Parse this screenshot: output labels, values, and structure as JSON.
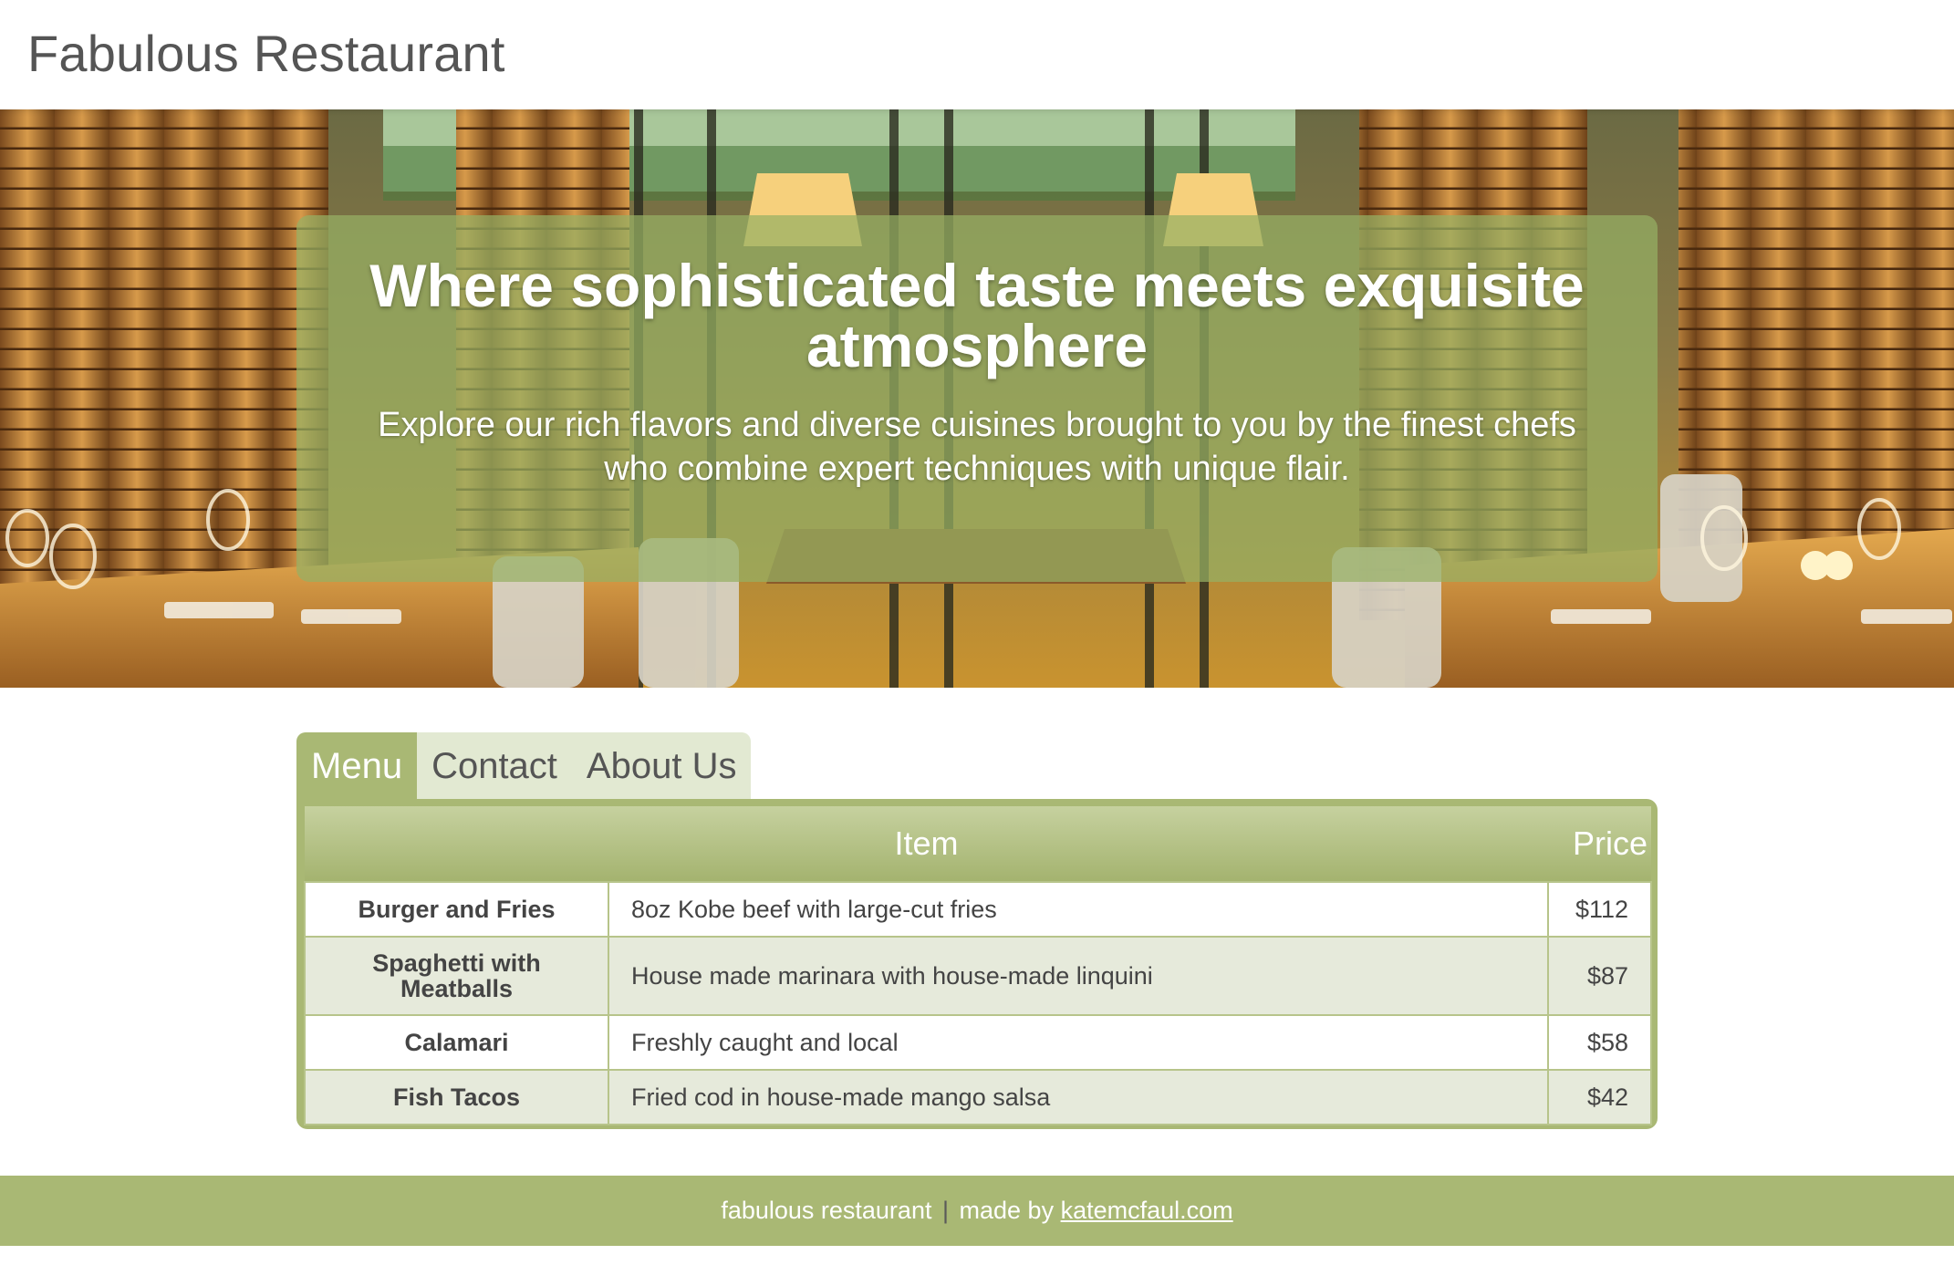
{
  "site": {
    "title": "Fabulous Restaurant"
  },
  "hero": {
    "heading": "Where sophisticated taste meets exquisite atmosphere",
    "text": "Explore our rich flavors and diverse cuisines brought to you by the finest chefs who combine expert techniques with unique flair."
  },
  "tabs": [
    {
      "label": "Menu",
      "active": true
    },
    {
      "label": "Contact",
      "active": false
    },
    {
      "label": "About Us",
      "active": false
    }
  ],
  "menu": {
    "headers": {
      "item": "Item",
      "price": "Price"
    },
    "rows": [
      {
        "name": "Burger and Fries",
        "description": "8oz Kobe beef with large-cut fries",
        "price": "$112"
      },
      {
        "name": "Spaghetti with Meatballs",
        "description": "House made marinara with house-made linquini",
        "price": "$87"
      },
      {
        "name": "Calamari",
        "description": "Freshly caught and local",
        "price": "$58"
      },
      {
        "name": "Fish Tacos",
        "description": "Fried cod in house-made mango salsa",
        "price": "$42"
      }
    ]
  },
  "footer": {
    "text": "fabulous restaurant",
    "separator": "|",
    "made_by": "made by",
    "link": "katemcfaul.com"
  },
  "colors": {
    "accent": "#a9b874",
    "panel_overlay": "#96b064",
    "row_alt": "#e6eadb"
  }
}
